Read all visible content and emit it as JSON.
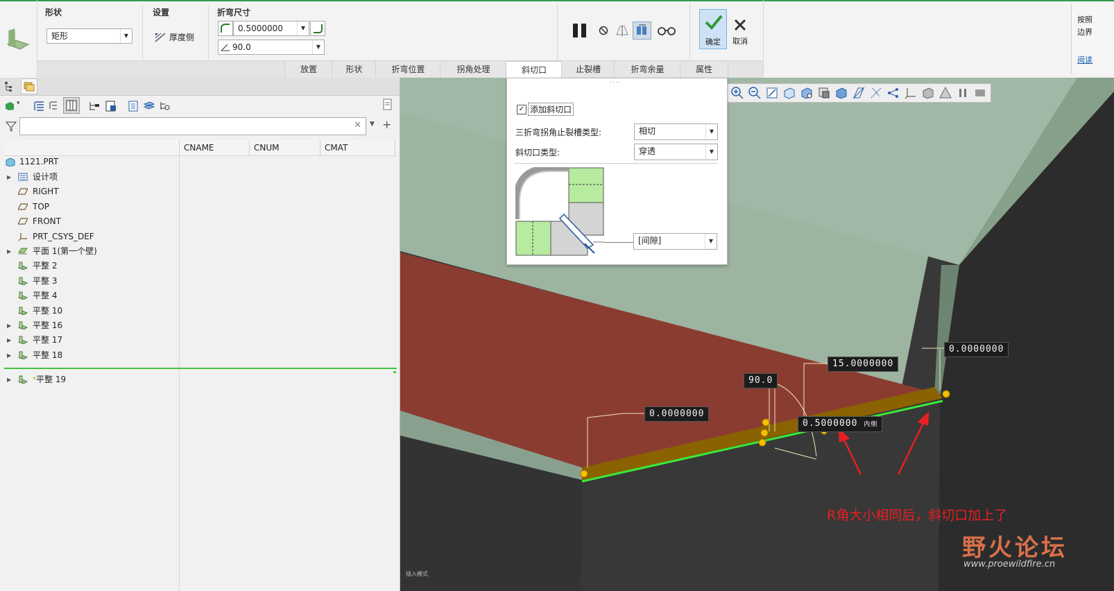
{
  "ribbon": {
    "shape_group": {
      "label": "形状",
      "value": "矩形"
    },
    "settings_group": {
      "label": "设置",
      "thickness_label": "厚度侧"
    },
    "bend_dims_group": {
      "label": "折弯尺寸",
      "radius_value": "0.5000000",
      "angle_value": "90.0"
    },
    "ok_label": "确定",
    "cancel_label": "取消",
    "side_text": [
      "按照",
      "边界",
      "阅读"
    ],
    "tabs": [
      "放置",
      "形状",
      "折弯位置",
      "拐角处理",
      "斜切口",
      "止裂槽",
      "折弯余量",
      "属性"
    ],
    "active_tab": "斜切口"
  },
  "tree": {
    "search_placeholder": "",
    "columns": [
      "CNAME",
      "CNUM",
      "CMAT"
    ],
    "root": "1121.PRT",
    "items": [
      {
        "label": "设计项",
        "icon": "design-items-icon",
        "expand": true
      },
      {
        "label": "RIGHT",
        "icon": "datum-plane-icon",
        "expand": false
      },
      {
        "label": "TOP",
        "icon": "datum-plane-icon",
        "expand": false
      },
      {
        "label": "FRONT",
        "icon": "datum-plane-icon",
        "expand": false
      },
      {
        "label": "PRT_CSYS_DEF",
        "icon": "csys-icon",
        "expand": false
      },
      {
        "label": "平面 1(第一个壁)",
        "icon": "planar-wall-icon",
        "expand": true
      },
      {
        "label": "平整 2",
        "icon": "flat-wall-icon",
        "expand": false
      },
      {
        "label": "平整 3",
        "icon": "flat-wall-icon",
        "expand": false
      },
      {
        "label": "平整 4",
        "icon": "flat-wall-icon",
        "expand": false
      },
      {
        "label": "平整 10",
        "icon": "flat-wall-icon",
        "expand": false
      },
      {
        "label": "平整 16",
        "icon": "flat-wall-icon",
        "expand": true
      },
      {
        "label": "平整 17",
        "icon": "flat-wall-icon",
        "expand": true
      },
      {
        "label": "平整 18",
        "icon": "flat-wall-icon",
        "expand": true
      }
    ],
    "insert_item": {
      "label": "平整 19",
      "prefix": "*"
    }
  },
  "popup": {
    "checkbox_label": "添加斜切口",
    "checked": true,
    "relief_label": "三折弯拐角止裂槽类型:",
    "relief_value": "相切",
    "miter_label": "斜切口类型:",
    "miter_value": "穿透",
    "gap_value": "[间隙]"
  },
  "viewport": {
    "dims": [
      "0.0000000",
      "15.0000000",
      "90.0",
      "0.5000000",
      "0.0000000"
    ],
    "side_tag": "内侧",
    "annotation": "R角大小相同后，斜切口加上了",
    "watermark_cn": "野火论坛",
    "watermark_en": "www.proewildfire.cn",
    "corner_text": "插入模式"
  },
  "colors": {
    "accent_green": "#2ed12e",
    "annotation_red": "#e82020",
    "sheet_green": "#9cb4a0",
    "face_red": "#8b3c31",
    "edge_orange": "#8a6200"
  }
}
